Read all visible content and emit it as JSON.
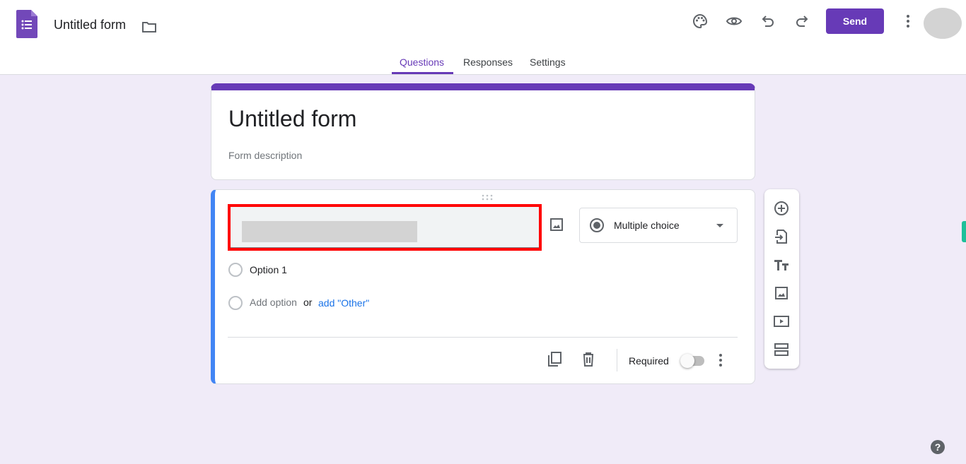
{
  "header": {
    "title": "Untitled form",
    "send_label": "Send"
  },
  "tabs": [
    {
      "label": "Questions",
      "active": true
    },
    {
      "label": "Responses"
    },
    {
      "label": "Settings"
    }
  ],
  "form": {
    "title": "Untitled form",
    "description_placeholder": "Form description"
  },
  "question": {
    "type": "Multiple choice",
    "options": [
      "Option 1"
    ],
    "add_option": "Add option",
    "or": "or",
    "add_other": "add \"Other\"",
    "required_label": "Required",
    "required": false
  },
  "colors": {
    "accent": "#673ab7",
    "active_border": "#4285f4",
    "highlight": "#ff0000",
    "background": "#f0ebf8"
  }
}
